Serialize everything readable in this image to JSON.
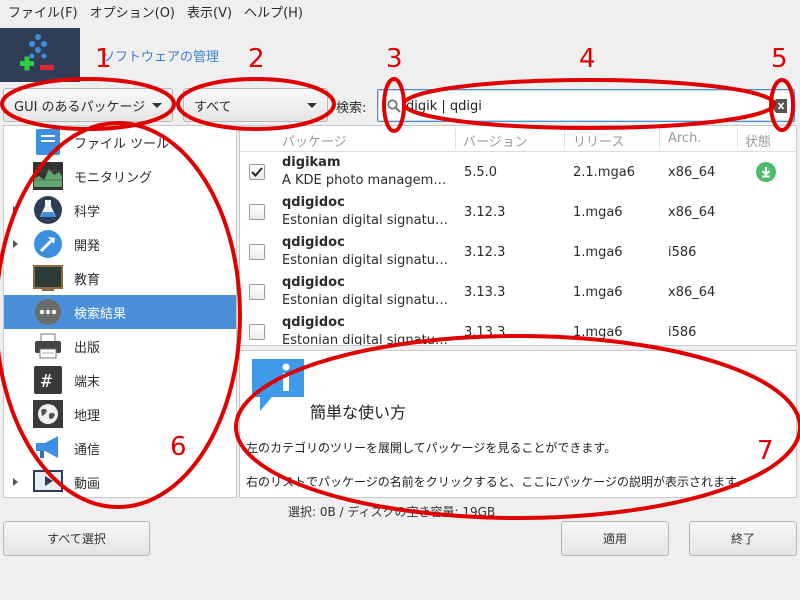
{
  "menubar": {
    "items": [
      {
        "label": "ファイル(F)"
      },
      {
        "label": "オプション(O)"
      },
      {
        "label": "表示(V)"
      },
      {
        "label": "ヘルプ(H)"
      }
    ]
  },
  "header": {
    "title": "ソフトウェアの管理"
  },
  "filters": {
    "type_combo": "GUI のあるパッケージ",
    "state_combo": "すべて",
    "search_label": "検索:",
    "search_value": "digik | qdigi"
  },
  "categories": [
    {
      "label": "ファイル ツール",
      "icon": "file-tools-icon",
      "expandable": false
    },
    {
      "label": "モニタリング",
      "icon": "monitoring-icon",
      "expandable": false
    },
    {
      "label": "科学",
      "icon": "science-icon",
      "expandable": true
    },
    {
      "label": "開発",
      "icon": "development-icon",
      "expandable": true
    },
    {
      "label": "教育",
      "icon": "education-icon",
      "expandable": false
    },
    {
      "label": "検索結果",
      "icon": "search-results-icon",
      "expandable": false,
      "selected": true
    },
    {
      "label": "出版",
      "icon": "publishing-icon",
      "expandable": false
    },
    {
      "label": "端末",
      "icon": "terminal-icon",
      "expandable": false
    },
    {
      "label": "地理",
      "icon": "geography-icon",
      "expandable": false
    },
    {
      "label": "通信",
      "icon": "communication-icon",
      "expandable": false
    },
    {
      "label": "動画",
      "icon": "video-icon",
      "expandable": true
    }
  ],
  "packages": {
    "headers": {
      "package": "パッケージ",
      "version": "バージョン",
      "release": "リリース",
      "arch": "Arch.",
      "status": "状態"
    },
    "rows": [
      {
        "name": "digikam",
        "desc": "A KDE photo managem…",
        "version": "5.5.0",
        "release": "2.1.mga6",
        "arch": "x86_64",
        "checked": true,
        "installed": true
      },
      {
        "name": "qdigidoc",
        "desc": "Estonian digital signatu…",
        "version": "3.12.3",
        "release": "1.mga6",
        "arch": "x86_64",
        "checked": false,
        "installed": false
      },
      {
        "name": "qdigidoc",
        "desc": "Estonian digital signatu…",
        "version": "3.12.3",
        "release": "1.mga6",
        "arch": "i586",
        "checked": false,
        "installed": false
      },
      {
        "name": "qdigidoc",
        "desc": "Estonian digital signatu…",
        "version": "3.13.3",
        "release": "1.mga6",
        "arch": "x86_64",
        "checked": false,
        "installed": false
      },
      {
        "name": "qdigidoc",
        "desc": "Estonian digital signatu…",
        "version": "3.13.3",
        "release": "1.mga6",
        "arch": "i586",
        "checked": false,
        "installed": false
      }
    ]
  },
  "info": {
    "title": "簡単な使い方",
    "line1": "左のカテゴリのツリーを展開してパッケージを見ることができます。",
    "line2": "右のリストでパッケージの名前をクリックすると、ここにパッケージの説明が表示されます。"
  },
  "status_text": "選択: 0B / ディスクの空き容量: 19GB",
  "buttons": {
    "select_all": "すべて選択",
    "apply": "適用",
    "quit": "終了"
  },
  "annotations": [
    "1",
    "2",
    "3",
    "4",
    "5",
    "6",
    "7"
  ],
  "colors": {
    "selection": "#4a90d9",
    "annotation": "#e00000",
    "installed": "#4cbb6c",
    "title_link": "#3f7fd2"
  }
}
